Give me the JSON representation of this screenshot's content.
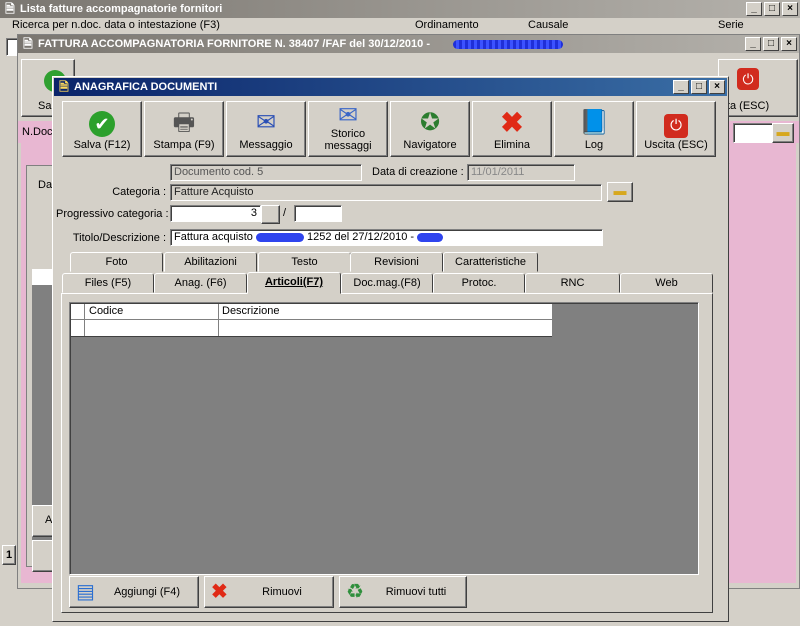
{
  "back_window": {
    "title": "Lista fatture accompagnatorie fornitori",
    "search_label": "Ricerca per n.doc. data o intestazione (F3)",
    "order_label": "Ordinamento",
    "causale_label": "Causale",
    "serie_label": "Serie",
    "left_fragments": [
      "N.Doc",
      "Da",
      "A",
      "1"
    ]
  },
  "mid_window": {
    "title": "FATTURA ACCOMPAGNATORIA FORNITORE N. 38407 /FAF del 30/12/2010 -",
    "left_fragment": "Sa",
    "exit_fragment": "cita (ESC)"
  },
  "dialog": {
    "title": "ANAGRAFICA DOCUMENTI",
    "toolbar": [
      {
        "label": "Salva (F12)",
        "icon": "check-icon"
      },
      {
        "label": "Stampa (F9)",
        "icon": "printer-icon"
      },
      {
        "label": "Messaggio",
        "icon": "message-pen-icon"
      },
      {
        "label": "Storico\nmessaggi",
        "icon": "message-history-icon"
      },
      {
        "label": "Navigatore",
        "icon": "compass-icon"
      },
      {
        "label": "Elimina",
        "icon": "delete-x-icon"
      },
      {
        "label": "Log",
        "icon": "log-book-icon"
      },
      {
        "label": "Uscita (ESC)",
        "icon": "exit-power-icon"
      }
    ],
    "doc_code": "Documento cod. 5",
    "created_label": "Data di creazione :",
    "created_value": "11/01/2011",
    "category_label": "Categoria :",
    "category_value": "Fatture Acquisto",
    "progressive_label": "Progressivo categoria :",
    "progressive_value": "3",
    "progressive_sep": "/",
    "progressive_suffix": "",
    "title_label": "Titolo/Descrizione :",
    "title_value_prefix": "Fattura acquisto ",
    "title_value_middle": " 1252 del 27/12/2010 - ",
    "tabs_row1": [
      "Foto",
      "Abilitazioni",
      "Testo",
      "Revisioni",
      "Caratteristiche"
    ],
    "tabs_row2": [
      "Files (F5)",
      "Anag. (F6)",
      "Articoli(F7)",
      "Doc.mag.(F8)",
      "Protoc.",
      "RNC",
      "Web"
    ],
    "grid_columns": [
      "Codice",
      "Descrizione"
    ],
    "grid_rows": [
      [
        "",
        ""
      ]
    ],
    "bottom_buttons": [
      "Aggiungi (F4)",
      "Rimuovi",
      "Rimuovi tutti"
    ]
  }
}
